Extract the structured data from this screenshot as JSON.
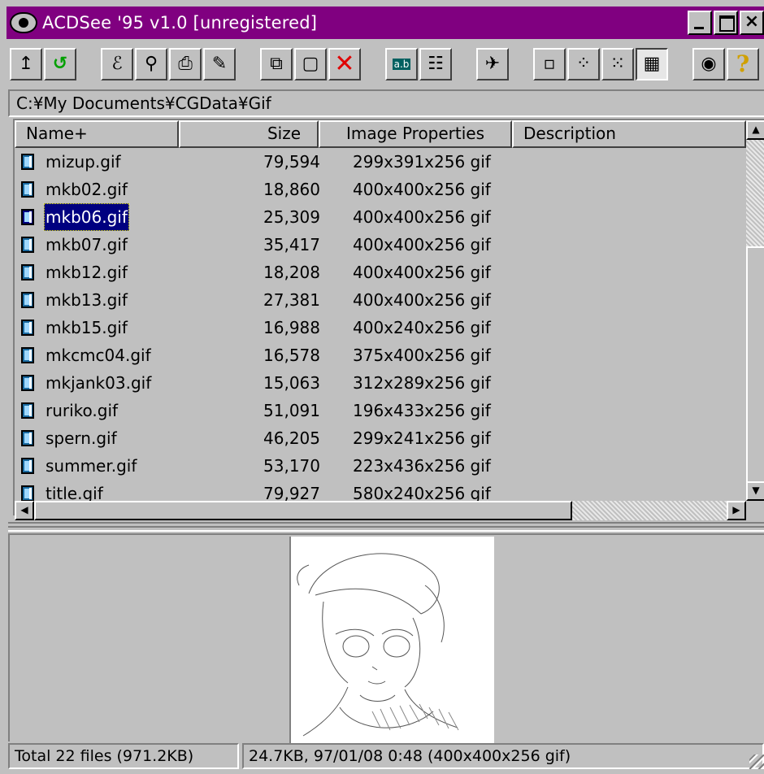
{
  "window": {
    "title": "ACDSee '95 v1.0 [unregistered]",
    "controls": {
      "minimize": "_",
      "maximize": "□",
      "close": "×"
    }
  },
  "toolbar": {
    "buttons": [
      {
        "name": "up-folder",
        "glyph": "↥"
      },
      {
        "name": "refresh",
        "glyph": "↺"
      },
      {
        "name": "set-folder",
        "glyph": "ℰ"
      },
      {
        "name": "find",
        "glyph": "⚲"
      },
      {
        "name": "print",
        "glyph": "⎙"
      },
      {
        "name": "open-with",
        "glyph": "✎"
      },
      {
        "name": "copy",
        "glyph": "⧉"
      },
      {
        "name": "paste",
        "glyph": "▢"
      },
      {
        "name": "delete",
        "glyph": "✕"
      },
      {
        "name": "rename",
        "glyph": "a.b"
      },
      {
        "name": "properties",
        "glyph": "☷"
      },
      {
        "name": "tools",
        "glyph": "✈"
      },
      {
        "name": "large-icons",
        "glyph": "▫"
      },
      {
        "name": "small-icons",
        "glyph": "⁘"
      },
      {
        "name": "list-view",
        "glyph": "⁙"
      },
      {
        "name": "details-view",
        "glyph": "▦"
      },
      {
        "name": "view-image",
        "glyph": "◉"
      },
      {
        "name": "help",
        "glyph": "?"
      }
    ]
  },
  "address": {
    "path": "C:¥My Documents¥CGData¥Gif"
  },
  "list": {
    "columns": [
      {
        "label": "Name+"
      },
      {
        "label": "Size"
      },
      {
        "label": "Image Properties"
      },
      {
        "label": "Description"
      }
    ],
    "rows": [
      {
        "name": "mizup.gif",
        "size": "79,594",
        "props": "299x391x256 gif",
        "selected": false
      },
      {
        "name": "mkb02.gif",
        "size": "18,860",
        "props": "400x400x256 gif",
        "selected": false
      },
      {
        "name": "mkb06.gif",
        "size": "25,309",
        "props": "400x400x256 gif",
        "selected": true
      },
      {
        "name": "mkb07.gif",
        "size": "35,417",
        "props": "400x400x256 gif",
        "selected": false
      },
      {
        "name": "mkb12.gif",
        "size": "18,208",
        "props": "400x400x256 gif",
        "selected": false
      },
      {
        "name": "mkb13.gif",
        "size": "27,381",
        "props": "400x400x256 gif",
        "selected": false
      },
      {
        "name": "mkb15.gif",
        "size": "16,988",
        "props": "400x240x256 gif",
        "selected": false
      },
      {
        "name": "mkcmc04.gif",
        "size": "16,578",
        "props": "375x400x256 gif",
        "selected": false
      },
      {
        "name": "mkjank03.gif",
        "size": "15,063",
        "props": "312x289x256 gif",
        "selected": false
      },
      {
        "name": "ruriko.gif",
        "size": "51,091",
        "props": "196x433x256 gif",
        "selected": false
      },
      {
        "name": "spern.gif",
        "size": "46,205",
        "props": "299x241x256 gif",
        "selected": false
      },
      {
        "name": "summer.gif",
        "size": "53,170",
        "props": "223x436x256 gif",
        "selected": false
      },
      {
        "name": "title.gif",
        "size": "79,927",
        "props": "580x240x256 gif",
        "selected": false
      }
    ]
  },
  "statusbar": {
    "total": "Total 22 files (971.2KB)",
    "info": "24.7KB, 97/01/08 0:48 (400x400x256 gif)"
  },
  "colors": {
    "titlebar": "#800080",
    "selection": "#000080",
    "face": "#c0c0c0"
  }
}
